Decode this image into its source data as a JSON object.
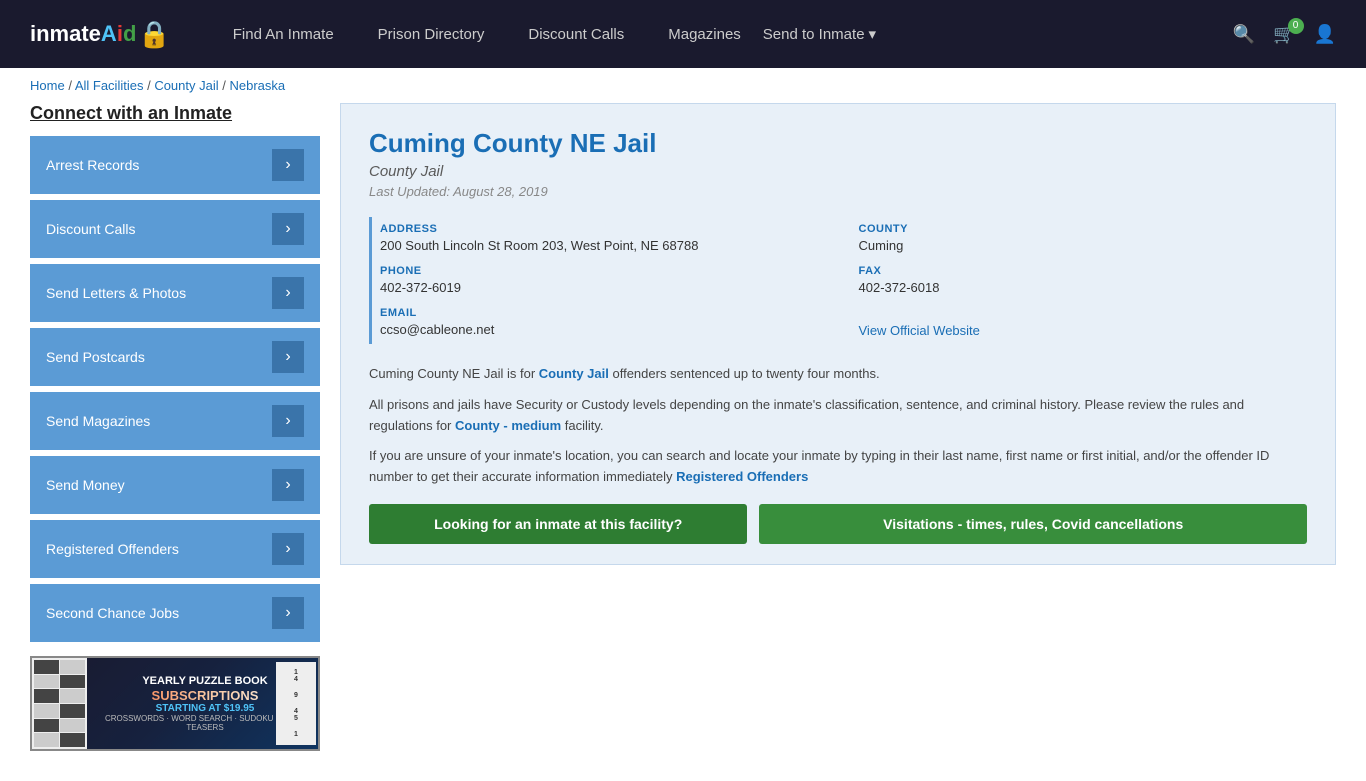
{
  "header": {
    "logo": "inmateAid",
    "nav": [
      {
        "label": "Find An Inmate",
        "id": "find-inmate"
      },
      {
        "label": "Prison Directory",
        "id": "prison-directory"
      },
      {
        "label": "Discount Calls",
        "id": "discount-calls"
      },
      {
        "label": "Magazines",
        "id": "magazines"
      },
      {
        "label": "Send to Inmate",
        "id": "send-to-inmate"
      }
    ],
    "cart_count": "0",
    "send_to_inmate_dropdown": "▾"
  },
  "breadcrumb": {
    "home": "Home",
    "separator1": " / ",
    "all_facilities": "All Facilities",
    "separator2": " / ",
    "county_jail": "County Jail",
    "separator3": " / ",
    "state": "Nebraska"
  },
  "sidebar": {
    "title": "Connect with an Inmate",
    "items": [
      {
        "label": "Arrest Records",
        "id": "arrest-records"
      },
      {
        "label": "Discount Calls",
        "id": "discount-calls"
      },
      {
        "label": "Send Letters & Photos",
        "id": "send-letters-photos"
      },
      {
        "label": "Send Postcards",
        "id": "send-postcards"
      },
      {
        "label": "Send Magazines",
        "id": "send-magazines"
      },
      {
        "label": "Send Money",
        "id": "send-money"
      },
      {
        "label": "Registered Offenders",
        "id": "registered-offenders"
      },
      {
        "label": "Second Chance Jobs",
        "id": "second-chance-jobs"
      }
    ],
    "ad": {
      "line1": "YEARLY PUZZLE BOOK",
      "line2": "SUBSCRIPTIONS",
      "line3": "STARTING AT $19.95",
      "line4": "CROSSWORDS · WORD SEARCH · SUDOKU · BRAIN TEASERS"
    }
  },
  "facility": {
    "name": "Cuming County NE Jail",
    "type": "County Jail",
    "last_updated": "Last Updated: August 28, 2019",
    "address_label": "ADDRESS",
    "address_value": "200 South Lincoln St Room 203, West Point, NE 68788",
    "county_label": "COUNTY",
    "county_value": "Cuming",
    "phone_label": "PHONE",
    "phone_value": "402-372-6019",
    "fax_label": "FAX",
    "fax_value": "402-372-6018",
    "email_label": "EMAIL",
    "email_value": "ccso@cableone.net",
    "website_label": "View Official Website",
    "desc1": "Cuming County NE Jail is for ",
    "county_jail_link": "County Jail",
    "desc1b": " offenders sentenced up to twenty four months.",
    "desc2": "All prisons and jails have Security or Custody levels depending on the inmate's classification, sentence, and criminal history. Please review the rules and regulations for ",
    "county_medium_link": "County - medium",
    "desc2b": " facility.",
    "desc3": "If you are unsure of your inmate's location, you can search and locate your inmate by typing in their last name, first name or first initial, and/or the offender ID number to get their accurate information immediately ",
    "registered_link": "Registered Offenders",
    "btn_looking": "Looking for an inmate at this facility?",
    "btn_visitations": "Visitations - times, rules, Covid cancellations"
  }
}
